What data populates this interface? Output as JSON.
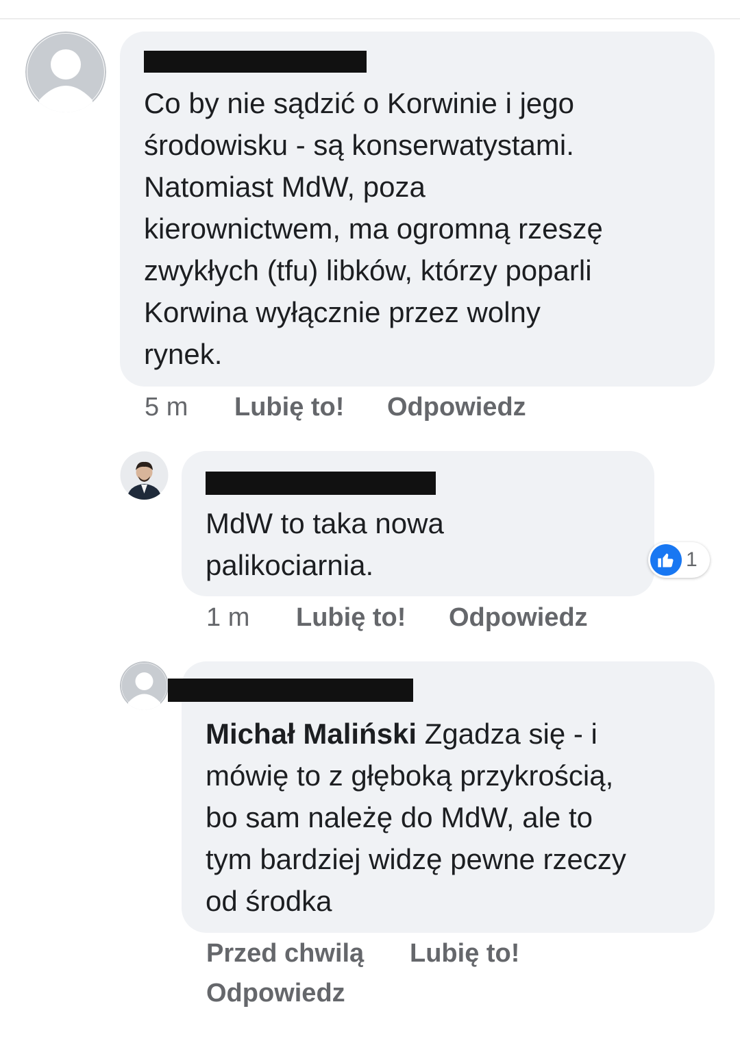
{
  "comments": [
    {
      "text": "Co by nie sądzić o Korwinie i jego\nśrodowisku - są konserwatystami.\nNatomiast MdW, poza\nkierownictwem, ma ogromną rzeszę\nzwykłych (tfu) libków, którzy poparli\nKorwina wyłącznie przez wolny\nrynek.",
      "time": "5 m",
      "like": "Lubię to!",
      "reply": "Odpowiedz"
    },
    {
      "text": "MdW to taka nowa\npalikociarnia.",
      "time": "1 m",
      "like": "Lubię to!",
      "reply": "Odpowiedz",
      "reaction_count": "1"
    },
    {
      "mention": "Michał Maliński",
      "text": " Zgadza się - i\nmówię to z głęboką przykrością,\nbo sam należę do MdW, ale to\ntym bardziej widzę pewne rzeczy\nod środka",
      "time": "Przed chwilą",
      "like": "Lubię to!",
      "reply": "Odpowiedz"
    }
  ],
  "colors": {
    "bubble": "#f0f2f5",
    "meta_text": "#65676b",
    "like_blue": "#1877f2"
  },
  "icons": {
    "default_avatar": "default-avatar-icon",
    "user_photo": "user-photo-avatar",
    "like": "thumbs-up-icon"
  }
}
